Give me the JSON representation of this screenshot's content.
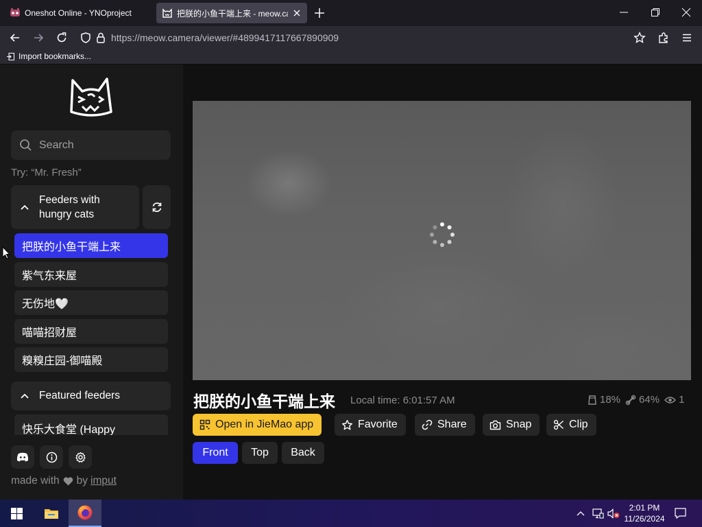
{
  "browser": {
    "tabs": [
      {
        "title": "Oneshot Online - YNOproject",
        "favicon": "yno-icon",
        "active": false
      },
      {
        "title": "把朕的小鱼干端上来 - meow.camera",
        "favicon": "cat-icon",
        "active": true
      }
    ],
    "url_host": "https://meow.camera",
    "url_path": "/viewer/#4899417117667890909",
    "bookmark_label": "Import bookmarks..."
  },
  "sidebar": {
    "search_placeholder": "Search",
    "try_text": "Try: “Mr. Fresh”",
    "group1_title": "Feeders with hungry cats",
    "feeders": [
      {
        "label": "把朕的小鱼干端上来",
        "active": true
      },
      {
        "label": "紫气东来屋",
        "active": false
      },
      {
        "label": "无伤地🤍",
        "active": false
      },
      {
        "label": "喵喵招财屋",
        "active": false
      },
      {
        "label": "糗糗庄园-御喵殿",
        "active": false
      }
    ],
    "group2_title": "Featured feeders",
    "featured_partial": "快乐大食堂 (Happy",
    "footer_icons": [
      "discord-icon",
      "info-icon",
      "settings-icon"
    ],
    "made_with": "made with",
    "by": "by",
    "author": "imput"
  },
  "stream": {
    "title": "把朕的小鱼干端上来",
    "local_time": "Local time: 6:01:57 AM",
    "stats": {
      "food": "18%",
      "cat": "64%",
      "viewers": "1"
    },
    "actions": {
      "open_app": "Open in JieMao app",
      "favorite": "Favorite",
      "share": "Share",
      "snap": "Snap",
      "clip": "Clip"
    },
    "cameras": [
      {
        "label": "Front",
        "active": true
      },
      {
        "label": "Top",
        "active": false
      },
      {
        "label": "Back",
        "active": false
      }
    ]
  },
  "taskbar": {
    "time": "2:01 PM",
    "date": "11/26/2024"
  },
  "colors": {
    "accent": "#3435e8",
    "app_button": "#f8c331",
    "sidebar_bg": "#191919",
    "page_bg": "#111111"
  }
}
